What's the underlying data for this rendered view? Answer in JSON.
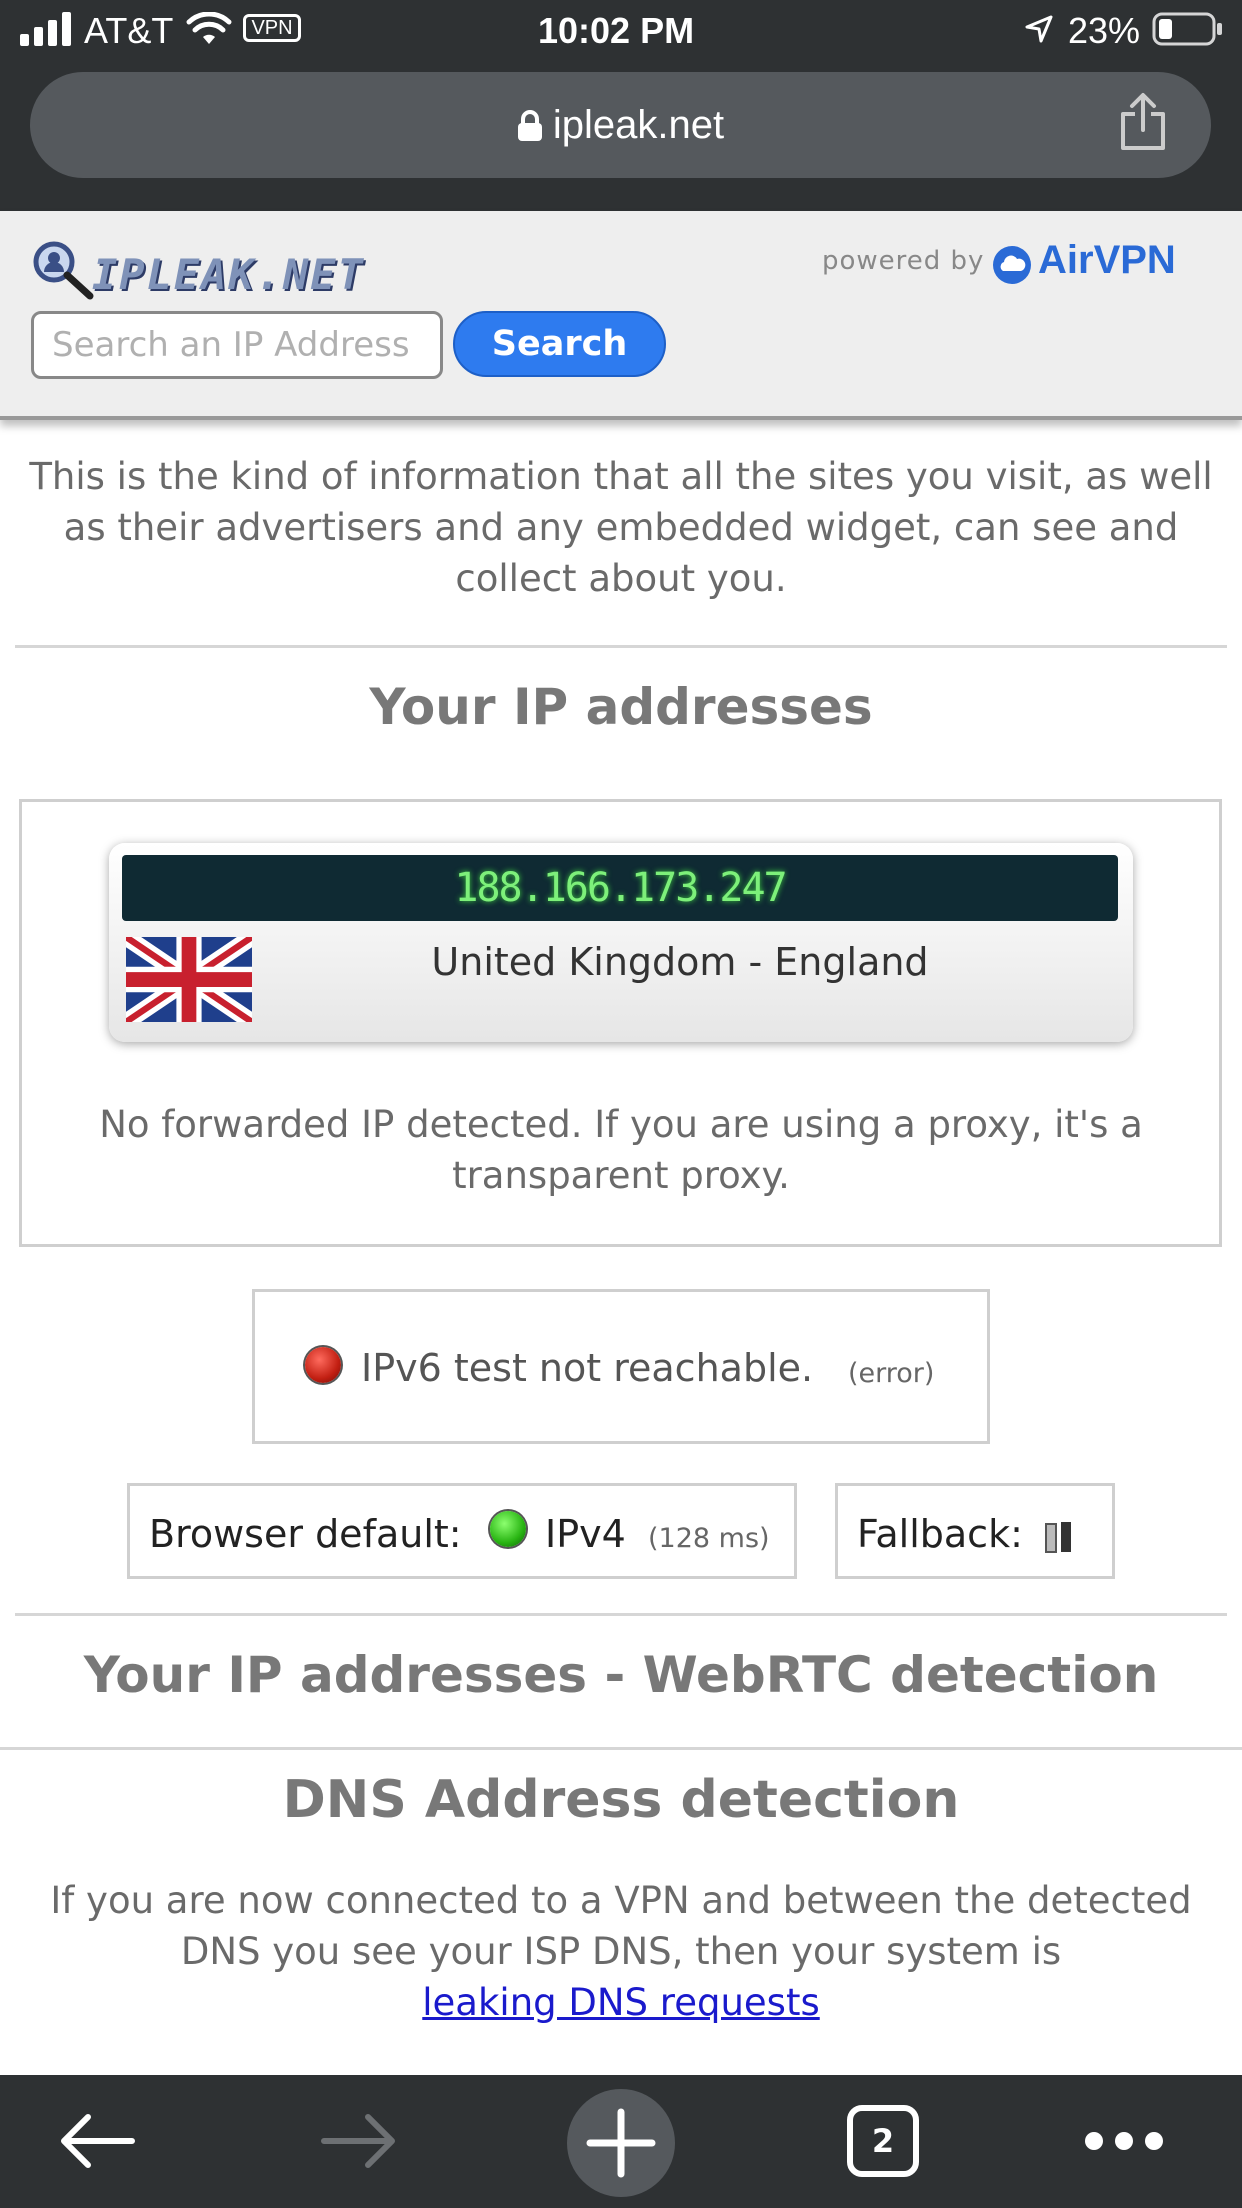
{
  "status_bar": {
    "carrier": "AT&T",
    "vpn": "VPN",
    "time": "10:02 PM",
    "battery": "23%"
  },
  "browser": {
    "url": "ipleak.net",
    "tab_count": "2"
  },
  "header": {
    "logo_text": "IPLEAK.NET",
    "powered_by": "powered by",
    "brand": "AirVPN",
    "search_placeholder": "Search an IP Address",
    "search_button": "Search"
  },
  "main": {
    "intro": "This is the kind of information that all the sites you visit, as well as their advertisers and any embedded widget, can see and collect about you.",
    "ip_section_title": "Your IP addresses",
    "ip_address": "188.166.173.247",
    "location": "United Kingdom - England",
    "forwarded_note": "No forwarded IP detected. If you are using a proxy, it's a transparent proxy.",
    "ipv6_status": "IPv6 test not reachable.",
    "ipv6_error": "(error)",
    "browser_default_label": "Browser default:",
    "ipv4_label": "IPv4",
    "ipv4_latency": "(128 ms)",
    "fallback_label": "Fallback:",
    "webrtc_title": "Your IP addresses - WebRTC detection",
    "dns_title": "DNS Address detection",
    "dns_text": "If you are now connected to a VPN and between the detected DNS you see your ISP DNS, then your system is",
    "dns_link": "leaking DNS requests"
  },
  "colors": {
    "accent": "#2e7bef",
    "ip_green": "#7df07a",
    "status_red": "#c21f12",
    "status_green": "#28b412",
    "link": "#1a1acc"
  },
  "icons": [
    "signal-icon",
    "wifi-icon",
    "lock-icon",
    "share-icon",
    "location-arrow-icon",
    "battery-icon",
    "back-icon",
    "forward-icon",
    "new-tab-icon",
    "tabs-icon",
    "more-icon",
    "uk-flag-icon",
    "airvpn-cloud-icon",
    "magnifier-logo-icon"
  ]
}
